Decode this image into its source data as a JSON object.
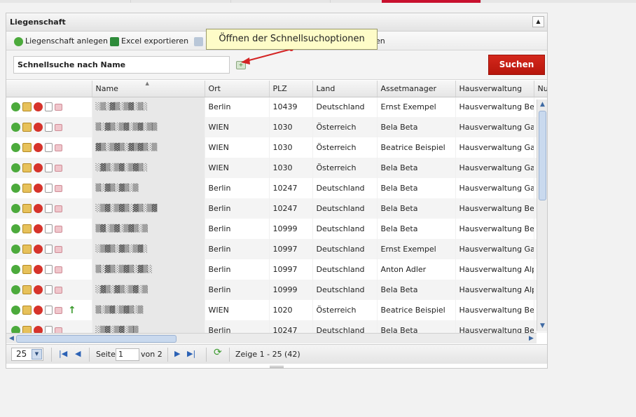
{
  "panel": {
    "title": "Liegenschaft",
    "collapse_icon": "▲"
  },
  "toolbar": {
    "create_label": "Liegenschaft anlegen",
    "excel_label": "Excel exportieren",
    "hidden_suffix": "en"
  },
  "search": {
    "placeholder": "Schnellsuche nach Name",
    "value": "Schnellsuche nach Name",
    "button_label": "Suchen"
  },
  "tooltip": {
    "text": "Öffnen der Schnellsuchoptionen"
  },
  "columns": [
    "Name",
    "Ort",
    "PLZ",
    "Land",
    "Assetmanager",
    "Hausverwaltung",
    "Nu"
  ],
  "rows": [
    {
      "name": "░▒░▓▒░▒▓░▒░",
      "ort": "Berlin",
      "plz": "10439",
      "land": "Deutschland",
      "am": "Ernst Exempel",
      "hv": "Hausverwaltung Beta"
    },
    {
      "name": "▒░▓▒░▒▓░▒▓░▒▒",
      "ort": "WIEN",
      "plz": "1030",
      "land": "Österreich",
      "am": "Bela Beta",
      "hv": "Hausverwaltung Gam"
    },
    {
      "name": "▓▒░▒▓▒░▓▒▓▒░▒",
      "ort": "WIEN",
      "plz": "1030",
      "land": "Österreich",
      "am": "Beatrice Beispiel",
      "hv": "Hausverwaltung Gam"
    },
    {
      "name": "░▓▒░▒▓░▒▓▒░",
      "ort": "WIEN",
      "plz": "1030",
      "land": "Österreich",
      "am": "Bela Beta",
      "hv": "Hausverwaltung Gam"
    },
    {
      "name": "▒░▓▒░▓▒░▒",
      "ort": "Berlin",
      "plz": "10247",
      "land": "Deutschland",
      "am": "Bela Beta",
      "hv": "Hausverwaltung Gam"
    },
    {
      "name": "░▒▓░▒▓▒░▓▒░▒▓",
      "ort": "Berlin",
      "plz": "10247",
      "land": "Deutschland",
      "am": "Bela Beta",
      "hv": "Hausverwaltung Beta"
    },
    {
      "name": "▒▓░▒▓░▒▓▒░▒",
      "ort": "Berlin",
      "plz": "10999",
      "land": "Deutschland",
      "am": "Bela Beta",
      "hv": "Hausverwaltung Beta"
    },
    {
      "name": "░▒▓▒░▓▒░▒▓░",
      "ort": "Berlin",
      "plz": "10997",
      "land": "Deutschland",
      "am": "Ernst Exempel",
      "hv": "Hausverwaltung Gam"
    },
    {
      "name": "▒░▓▒░▒▓▒░▓▒░",
      "ort": "Berlin",
      "plz": "10997",
      "land": "Deutschland",
      "am": "Anton Adler",
      "hv": "Hausverwaltung Alph"
    },
    {
      "name": "░▓▒░▓▒░▒▓░▒",
      "ort": "Berlin",
      "plz": "10999",
      "land": "Deutschland",
      "am": "Bela Beta",
      "hv": "Hausverwaltung Alph"
    },
    {
      "name": "▒░▒▓░▒▓▒░▒",
      "ort": "WIEN",
      "plz": "1020",
      "land": "Österreich",
      "am": "Beatrice Beispiel",
      "hv": "Hausverwaltung Beta"
    },
    {
      "name": "░▒▓░▒▓░▒▒",
      "ort": "Berlin",
      "plz": "10247",
      "land": "Deutschland",
      "am": "Bela Beta",
      "hv": "Hausverwaltung Beta"
    }
  ],
  "pager": {
    "page_size": "25",
    "page_label": "Seite",
    "page_value": "1",
    "of_label": "von 2",
    "summary": "Zeige 1 - 25 (42)"
  },
  "colors": {
    "accent": "#c8102e",
    "ok": "#4caa3c",
    "delete": "#d6332b"
  }
}
